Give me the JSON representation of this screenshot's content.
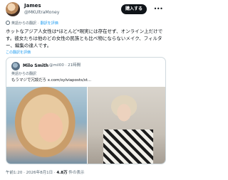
{
  "author": {
    "name": "James",
    "handle": "@MKUltraMoney"
  },
  "follow_button_label": "購入する",
  "more_icon_glyph": "•••",
  "translation_note": {
    "label": "英語からの翻訳",
    "rate_link": "翻訳を評価"
  },
  "tweet_text": "ホットなアジア人女性は*ほとんど*現実には存在せず、オンライン上だけです。彼女たちは他のどの女性の民族とも比べ物にならないメイク、フィルター、編集の達人です。",
  "show_original_label": "この翻訳を評価",
  "quote": {
    "author_name": "Milo Smith",
    "author_handle": "@mil00 · 21時間",
    "translation_note": "英語からの翻訳",
    "text": "もうマジで冗談だろ x.com/sylviaposts/st..."
  },
  "meta": {
    "time": "午前1:20 · 2026年8月1日 · ",
    "views_count": "4.8万",
    "views_label": " 件の表示"
  }
}
